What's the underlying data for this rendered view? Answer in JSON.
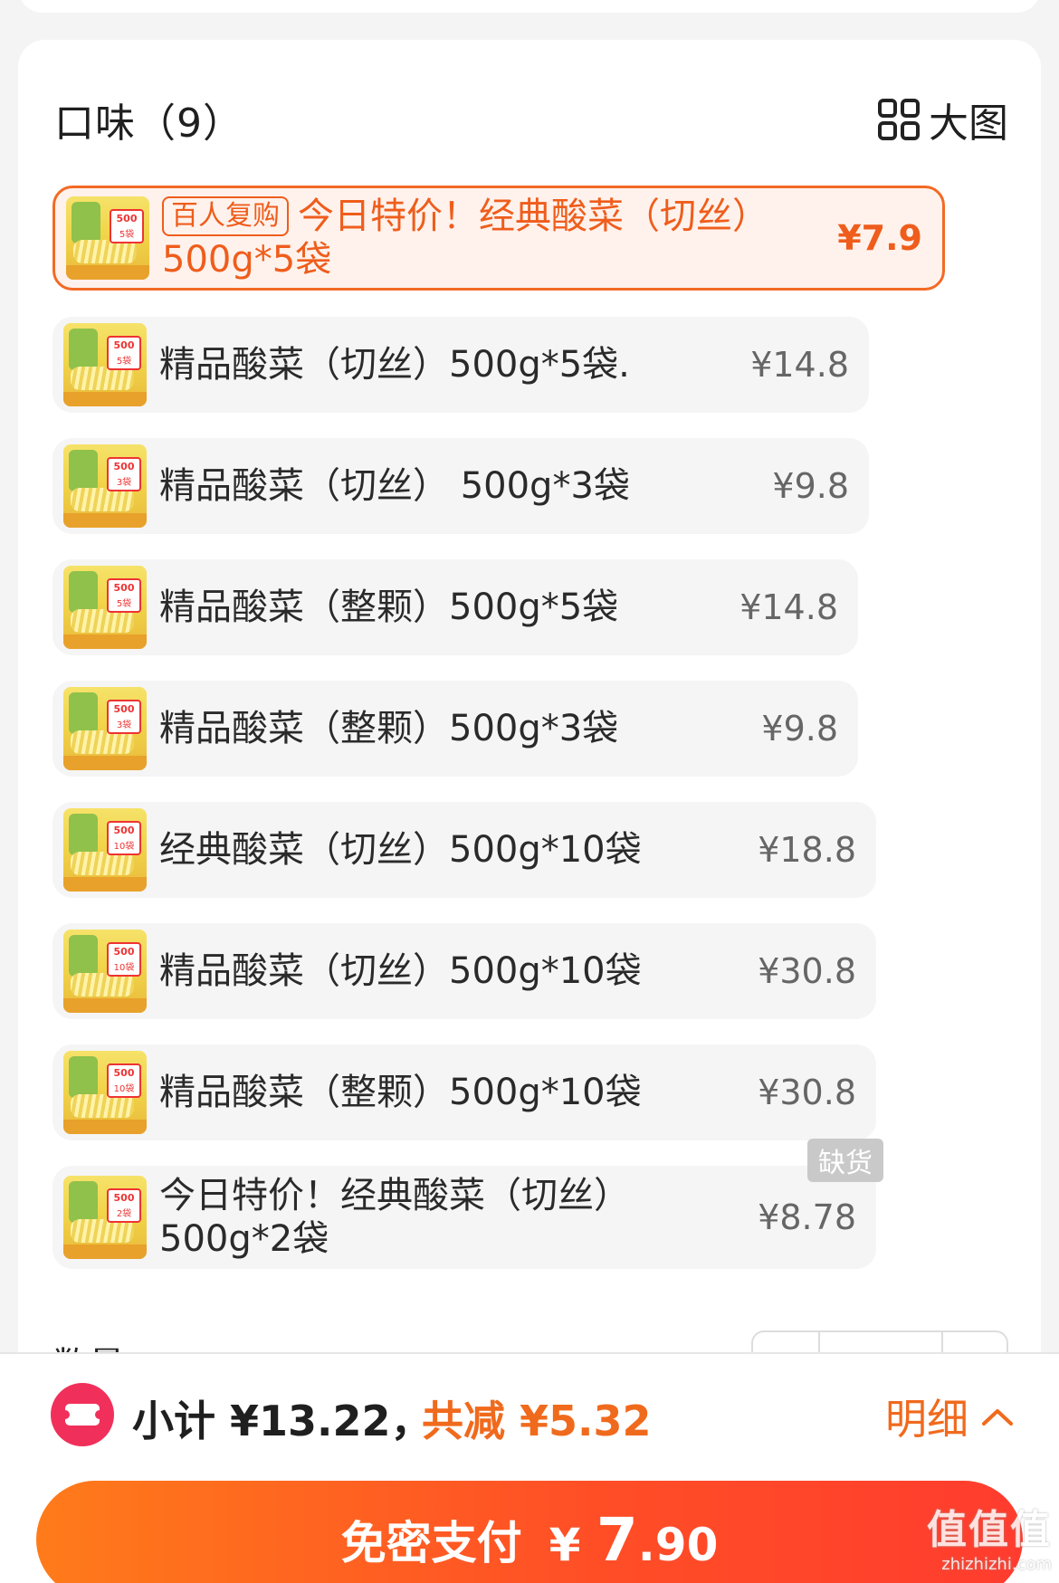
{
  "flavor_section": {
    "title": "口味（9）",
    "view_toggle_label": "大图",
    "options": [
      {
        "tag": "百人复购",
        "label": "今日特价！经典酸菜（切丝）500g*5袋",
        "price": "¥7.9",
        "selected": true,
        "thumb_qty": "5袋"
      },
      {
        "label": "精品酸菜（切丝）500g*5袋.",
        "price": "¥14.8",
        "thumb_qty": "5袋"
      },
      {
        "label": "精品酸菜（切丝） 500g*3袋",
        "price": "¥9.8",
        "thumb_qty": "3袋"
      },
      {
        "label": "精品酸菜（整颗）500g*5袋",
        "price": "¥14.8",
        "thumb_qty": "5袋"
      },
      {
        "label": "精品酸菜（整颗）500g*3袋",
        "price": "¥9.8",
        "thumb_qty": "3袋"
      },
      {
        "label": "经典酸菜（切丝）500g*10袋",
        "price": "¥18.8",
        "thumb_qty": "10袋"
      },
      {
        "label": "精品酸菜（切丝）500g*10袋",
        "price": "¥30.8",
        "thumb_qty": "10袋"
      },
      {
        "label": "精品酸菜（整颗）500g*10袋",
        "price": "¥30.8",
        "thumb_qty": "10袋"
      },
      {
        "label": "今日特价！经典酸菜（切丝）500g*2袋",
        "price": "¥8.78",
        "thumb_qty": "2袋",
        "badge": "缺货"
      }
    ],
    "thumb_weight": "500"
  },
  "quantity": {
    "label": "数量"
  },
  "summary": {
    "subtotal_text": "小计 ¥13.22，",
    "discount_text": "共减 ¥5.32",
    "detail_label": "明细"
  },
  "pay": {
    "label": "免密支付",
    "currency": "¥",
    "amount_int": "7",
    "amount_dec": ".90"
  },
  "watermark": {
    "main": "值值值",
    "sub": "zhizhizhi.com"
  },
  "colors": {
    "accent": "#f06a1d",
    "coupon": "#f0305a",
    "selected_bg": "#fff2ec"
  }
}
